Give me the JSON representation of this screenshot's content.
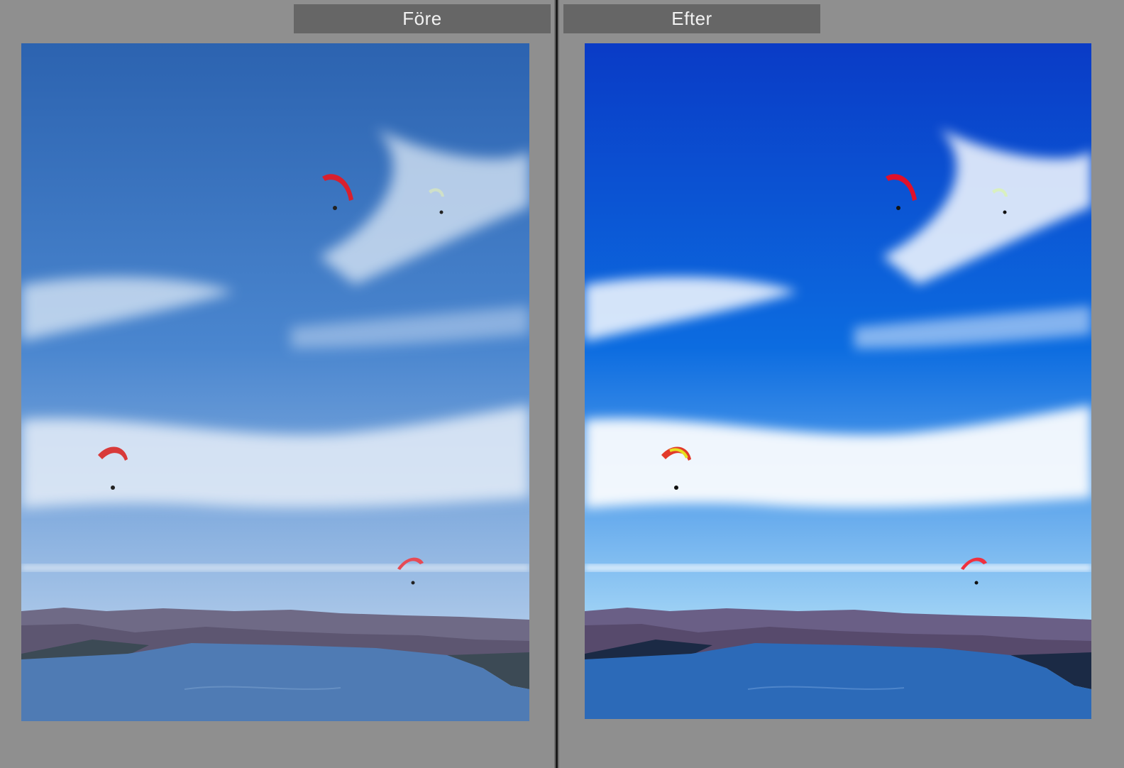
{
  "compare_view": {
    "before": {
      "label": "Före",
      "sky_top": "#2c63b0",
      "sky_mid": "#4a86cf",
      "sky_low": "#a9c6e8",
      "cloud": "#dfeaf6",
      "mountain": "#6f6a86",
      "shore": "#3c4a55",
      "water": "#4f7bb4"
    },
    "after": {
      "label": "Efter",
      "sky_top": "#0a3bc6",
      "sky_mid": "#0c6ce0",
      "sky_low": "#9fd2f5",
      "cloud": "#f8fbff",
      "mountain": "#6a5f86",
      "shore": "#1b2a45",
      "water": "#2c6ab8"
    }
  }
}
